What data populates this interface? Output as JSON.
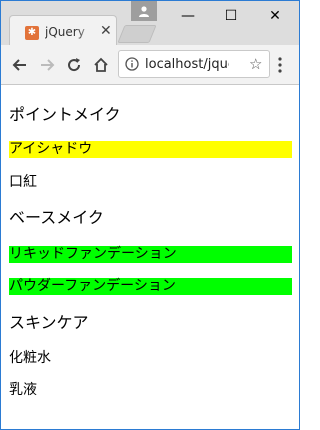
{
  "browser": {
    "tab_title": "jQuery",
    "tab_close": "✕",
    "favicon": "favicon-icon",
    "window_minimize": "—",
    "window_maximize": "☐",
    "window_close": "✕",
    "url": "localhost/jque"
  },
  "colors": {
    "highlight_yellow": "#ffff00",
    "highlight_green": "#00ff00"
  },
  "sections": [
    {
      "heading": "ポイントメイク",
      "items": [
        {
          "label": "アイシャドウ",
          "highlight": "yellow"
        },
        {
          "label": "口紅",
          "highlight": "none"
        }
      ]
    },
    {
      "heading": "ベースメイク",
      "items": [
        {
          "label": "リキッドファンデーション",
          "highlight": "green"
        },
        {
          "label": "パウダーファンデーション",
          "highlight": "green"
        }
      ]
    },
    {
      "heading": "スキンケア",
      "items": [
        {
          "label": "化粧水",
          "highlight": "none"
        },
        {
          "label": "乳液",
          "highlight": "none"
        }
      ]
    }
  ]
}
